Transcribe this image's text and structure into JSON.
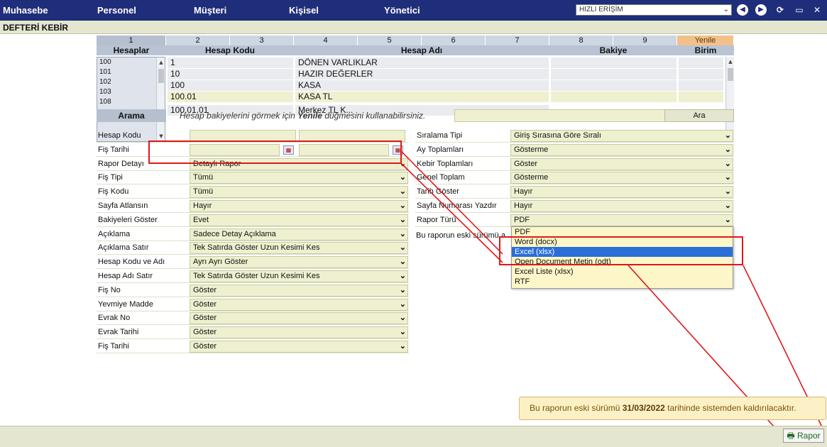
{
  "nav": {
    "items": [
      "Muhasebe",
      "Personel",
      "Müşteri",
      "Kişisel",
      "Yönetici"
    ],
    "quick_access": "HIZLI ERİŞİM"
  },
  "page_title": "DEFTERİ KEBİR",
  "grid": {
    "column_numbers": [
      "1",
      "2",
      "3",
      "4",
      "5",
      "6",
      "7",
      "8",
      "9"
    ],
    "refresh_label": "Yenile",
    "headers": {
      "hesaplar": "Hesaplar",
      "hesap_kodu": "Hesap Kodu",
      "hesap_adi": "Hesap Adı",
      "bakiye": "Bakiye",
      "birim": "Birim"
    },
    "code_list": [
      "100",
      "101",
      "102",
      "103",
      "108"
    ],
    "rows": [
      {
        "code": "1",
        "name": "DÖNEN VARLIKLAR"
      },
      {
        "code": "10",
        "name": "HAZIR DEĞERLER"
      },
      {
        "code": "100",
        "name": "KASA"
      },
      {
        "code": "100.01",
        "name": "KASA TL"
      },
      {
        "code": "100.01.01",
        "name": "Merkez TL K..."
      }
    ]
  },
  "search": {
    "label": "Arama",
    "hint_pre": "Hesap bakiyelerini görmek için ",
    "hint_bold": "Yenile",
    "hint_post": " düğmesini kullanabilirsiniz.",
    "button": "Ara"
  },
  "form_left": [
    {
      "label": "Hesap Kodu",
      "type": "text2"
    },
    {
      "label": "Fiş Tarihi",
      "type": "date2"
    },
    {
      "label": "Rapor Detayı",
      "value": "Detaylı Rapor"
    },
    {
      "label": "Fiş Tipi",
      "value": "Tümü"
    },
    {
      "label": "Fiş Kodu",
      "value": "Tümü"
    },
    {
      "label": "Sayfa Atlansın",
      "value": "Hayır"
    },
    {
      "label": "Bakiyeleri Göster",
      "value": "Evet"
    },
    {
      "label": "Açıklama",
      "value": "Sadece Detay Açıklama"
    },
    {
      "label": "Açıklama Satır",
      "value": "Tek Satırda Göster Uzun Kesimi Kes"
    },
    {
      "label": "Hesap Kodu ve Adı",
      "value": "Ayrı Ayrı Göster"
    },
    {
      "label": "Hesap Adı Satır",
      "value": "Tek Satırda Göster Uzun Kesimi Kes"
    },
    {
      "label": "Fiş No",
      "value": "Göster"
    },
    {
      "label": "Yevmiye Madde",
      "value": "Göster"
    },
    {
      "label": "Evrak No",
      "value": "Göster"
    },
    {
      "label": "Evrak Tarihi",
      "value": "Göster"
    },
    {
      "label": "Fiş Tarihi",
      "value": "Göster"
    }
  ],
  "form_right": [
    {
      "label": "Sıralama Tipi",
      "value": "Giriş Sırasına Göre Sıralı"
    },
    {
      "label": "Ay Toplamları",
      "value": "Gösterme"
    },
    {
      "label": "Kebir Toplamları",
      "value": "Göster"
    },
    {
      "label": "Genel Toplam",
      "value": "Gösterme"
    },
    {
      "label": "Tarih Göster",
      "value": "Hayır"
    },
    {
      "label": "Sayfa Numarası Yazdır",
      "value": "Hayır"
    },
    {
      "label": "Rapor Türü",
      "value": "PDF"
    }
  ],
  "small_note": "Bu raporun eski sürümü a",
  "report_type_options": [
    "PDF",
    "Word (docx)",
    "Excel (xlsx)",
    "Open Document Metin (odt)",
    "Excel Liste (xlsx)",
    "RTF"
  ],
  "report_type_active": "Excel (xlsx)",
  "toast": {
    "pre": "Bu raporun eski sürümü ",
    "date": "31/03/2022",
    "post": " tarihinde sistemden kaldırılacaktır."
  },
  "rapor_button": "Rapor",
  "colors": {
    "nav_bg": "#1f2e7a",
    "annotation_red": "#e01818",
    "highlight_blue": "#2a6fd8"
  }
}
